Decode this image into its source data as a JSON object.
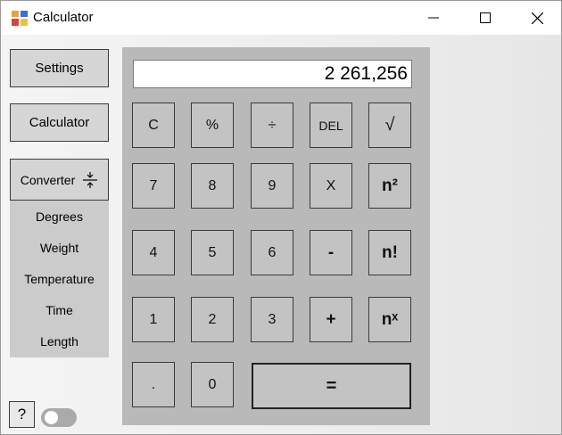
{
  "window": {
    "title": "Calculator",
    "minimize_glyph": "–",
    "maximize_glyph": "☐",
    "close_glyph": "✕"
  },
  "sidebar": {
    "settings_label": "Settings",
    "calculator_label": "Calculator",
    "converter_label": "Converter",
    "converter_items": [
      "Degrees",
      "Weight",
      "Temperature",
      "Time",
      "Length"
    ],
    "help_label": "?"
  },
  "calculator": {
    "display_value": "2 261,256",
    "keys": {
      "clear": "C",
      "percent": "%",
      "divide": "÷",
      "delete": "DEL",
      "sqrt": "√",
      "seven": "7",
      "eight": "8",
      "nine": "9",
      "multiply": "X",
      "square": "n²",
      "four": "4",
      "five": "5",
      "six": "6",
      "minus": "-",
      "factorial": "n!",
      "one": "1",
      "two": "2",
      "three": "3",
      "plus": "+",
      "power": "nˣ",
      "decimal": ".",
      "zero": "0",
      "equals": "="
    }
  }
}
